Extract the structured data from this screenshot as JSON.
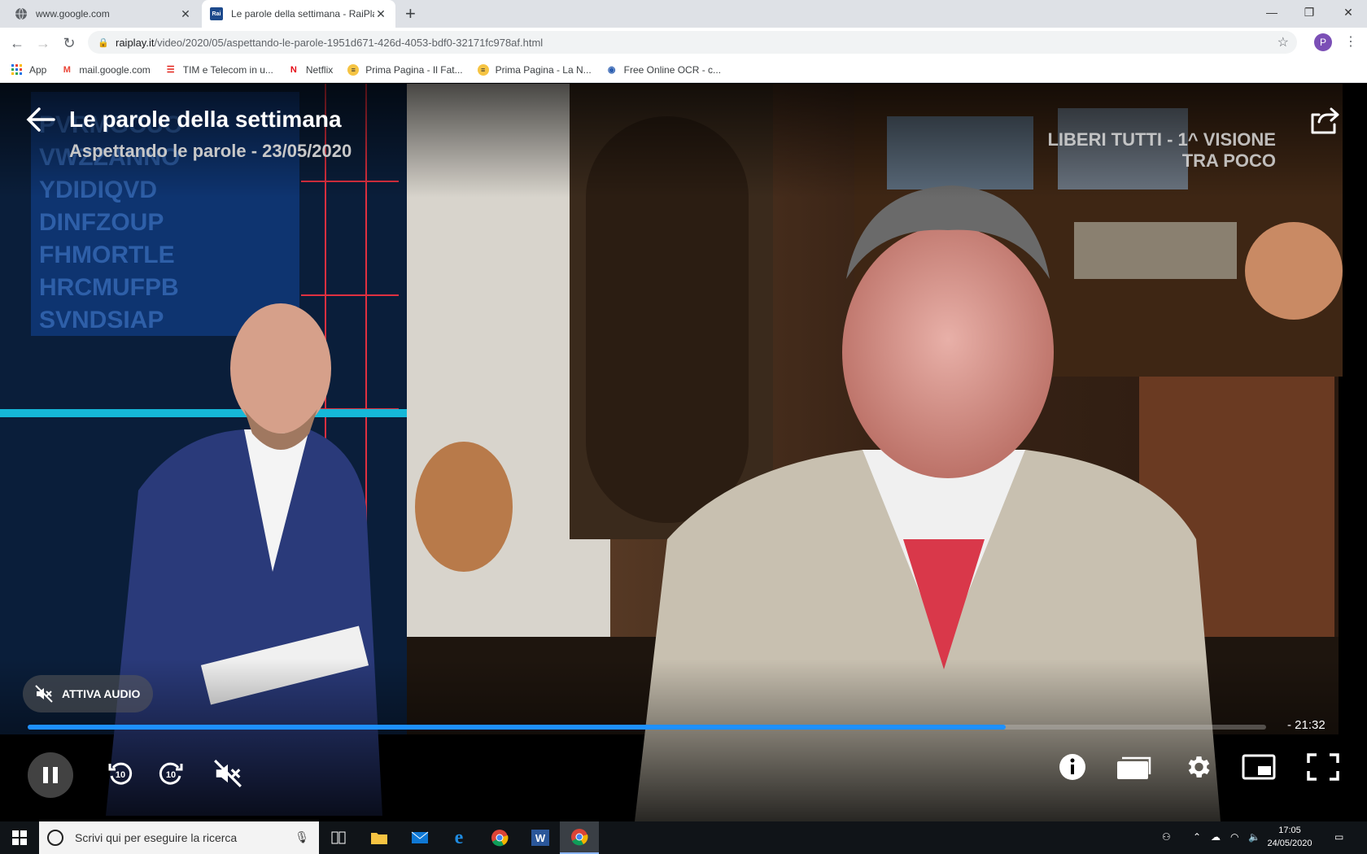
{
  "browser": {
    "tabs": [
      {
        "title": "www.google.com",
        "favicon": "globe-icon",
        "active": false
      },
      {
        "title": "Le parole della settimana - RaiPla",
        "favicon": "rai-icon",
        "favicon_text": "Rai",
        "active": true
      }
    ],
    "address": {
      "host": "raiplay.it",
      "path": "/video/2020/05/aspettando-le-parole-1951d671-426d-4053-bdf0-32171fc978af.html"
    },
    "profile_initial": "P",
    "bookmarks": [
      {
        "label": "App",
        "icon": "apps-grid-icon"
      },
      {
        "label": "mail.google.com",
        "icon": "gmail-icon"
      },
      {
        "label": "TIM e Telecom in u...",
        "icon": "tim-icon"
      },
      {
        "label": "Netflix",
        "icon": "netflix-icon"
      },
      {
        "label": "Prima Pagina - Il Fat...",
        "icon": "newspaper-icon"
      },
      {
        "label": "Prima Pagina - La N...",
        "icon": "newspaper-icon"
      },
      {
        "label": "Free Online OCR - c...",
        "icon": "ocr-icon"
      }
    ]
  },
  "player": {
    "title": "Le parole della settimana",
    "subtitle": "Aspettando le parole - 23/05/2020",
    "overlay": [
      "LIBERI TUTTI - 1^ VISIONE",
      "TRA POCO"
    ],
    "audio_button": "ATTIVA AUDIO",
    "progress_fraction": 0.79,
    "remaining_time": "- 21:32",
    "accent": "#1e90ff"
  },
  "taskbar": {
    "search_placeholder": "Scrivi qui per eseguire la ricerca",
    "time": "17:05",
    "date": "24/05/2020"
  }
}
